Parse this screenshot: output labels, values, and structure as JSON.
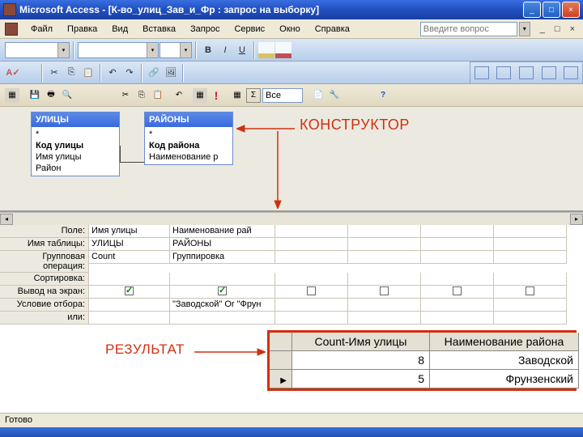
{
  "titlebar": {
    "title": "Microsoft Access - [К-во_улиц_Зав_и_Фр : запрос на выборку]"
  },
  "menu": {
    "file": "Файл",
    "edit": "Правка",
    "view": "Вид",
    "insert": "Вставка",
    "query": "Запрос",
    "service": "Сервис",
    "window": "Окно",
    "help": "Справка"
  },
  "help_placeholder": "Введите вопрос",
  "toolbar3": {
    "textval": "Все"
  },
  "design": {
    "table1": {
      "title": "УЛИЦЫ",
      "star": "*",
      "f1": "Код улицы",
      "f2": "Имя улицы",
      "f3": "Район"
    },
    "table2": {
      "title": "РАЙОНЫ",
      "star": "*",
      "f1": "Код района",
      "f2": "Наименование р"
    },
    "label_konstruktor": "КОНСТРУКТОР"
  },
  "grid": {
    "labels": {
      "field": "Поле:",
      "table": "Имя таблицы:",
      "group": "Групповая операция:",
      "sort": "Сортировка:",
      "show": "Вывод на экран:",
      "criteria": "Условие отбора:",
      "or": "или:"
    },
    "col1": {
      "field": "Имя улицы",
      "table": "УЛИЦЫ",
      "group": "Count",
      "show": true
    },
    "col2": {
      "field": "Наименование рай",
      "table": "РАЙОНЫ",
      "group": "Группировка",
      "show": true,
      "criteria": "\"Заводской\" Or \"Фрун"
    },
    "col3": {
      "show": false
    },
    "col4": {
      "show": false
    },
    "col5": {
      "show": false
    }
  },
  "result": {
    "label": "РЕЗУЛЬТАТ",
    "headers": {
      "count": "Count-Имя улицы",
      "name": "Наименование района"
    },
    "rows": [
      {
        "count": "8",
        "name": "Заводской",
        "current": false
      },
      {
        "count": "5",
        "name": "Фрунзенский",
        "current": true
      }
    ]
  },
  "statusbar": "Готово"
}
